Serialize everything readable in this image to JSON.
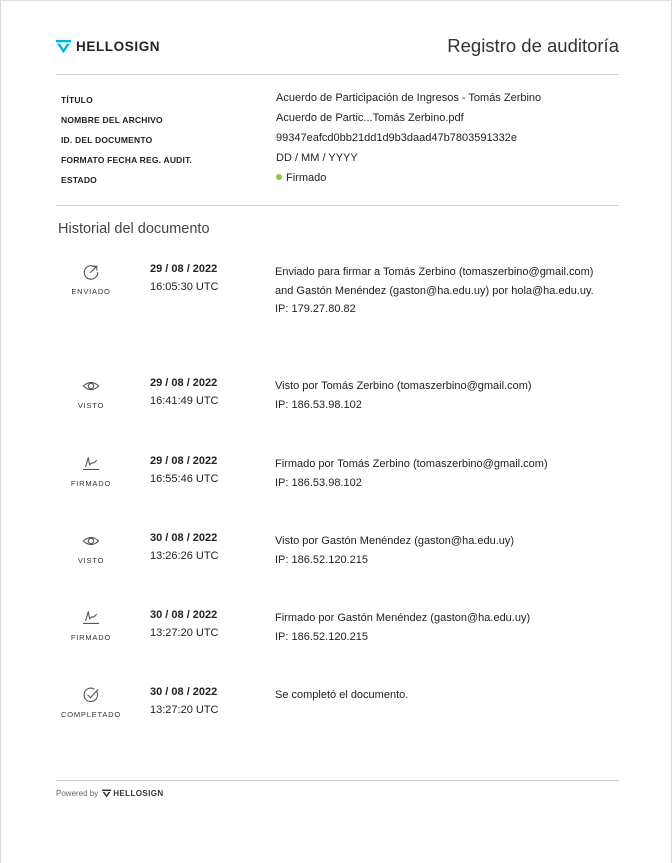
{
  "brand": {
    "name": "HELLOSIGN",
    "accent": "#00b3e6"
  },
  "header": {
    "title": "Registro de auditoría"
  },
  "metadata": [
    {
      "label": "TÍTULO",
      "value": "Acuerdo de Participación de Ingresos - Tomás Zerbino"
    },
    {
      "label": "NOMBRE DEL ARCHIVO",
      "value": "Acuerdo de Partic...Tomás Zerbino.pdf"
    },
    {
      "label": "ID. DEL DOCUMENTO",
      "value": "99347eafcd0bb21dd1d9b3daad47b7803591332e"
    },
    {
      "label": "FORMATO FECHA REG. AUDIT.",
      "value": "DD / MM / YYYY"
    },
    {
      "label": "ESTADO",
      "value": "Firmado",
      "status_color": "#8dc63f"
    }
  ],
  "history": {
    "title": "Historial del documento",
    "events": [
      {
        "icon": "sent-icon",
        "label": "ENVIADO",
        "date": "29 / 08 / 2022",
        "time": "16:05:30 UTC",
        "desc": "Enviado para firmar a Tomás Zerbino (tomaszerbino@gmail.com) and Gastón Menéndez (gaston@ha.edu.uy) por hola@ha.edu.uy.",
        "ip": "IP: 179.27.80.82"
      },
      {
        "icon": "eye-icon",
        "label": "VISTO",
        "date": "29 / 08 / 2022",
        "time": "16:41:49 UTC",
        "desc": "Visto por Tomás Zerbino (tomaszerbino@gmail.com)",
        "ip": "IP: 186.53.98.102"
      },
      {
        "icon": "signature-icon",
        "label": "FIRMADO",
        "date": "29 / 08 / 2022",
        "time": "16:55:46 UTC",
        "desc": "Firmado por Tomás Zerbino (tomaszerbino@gmail.com)",
        "ip": "IP: 186.53.98.102"
      },
      {
        "icon": "eye-icon",
        "label": "VISTO",
        "date": "30 / 08 / 2022",
        "time": "13:26:26 UTC",
        "desc": "Visto por Gastón Menéndez (gaston@ha.edu.uy)",
        "ip": "IP: 186.52.120.215"
      },
      {
        "icon": "signature-icon",
        "label": "FIRMADO",
        "date": "30 / 08 / 2022",
        "time": "13:27:20 UTC",
        "desc": "Firmado por Gastón Menéndez (gaston@ha.edu.uy)",
        "ip": "IP: 186.52.120.215"
      },
      {
        "icon": "check-circle-icon",
        "label": "COMPLETADO",
        "date": "30 / 08 / 2022",
        "time": "13:27:20 UTC",
        "desc": "Se completó el documento.",
        "ip": ""
      }
    ]
  },
  "footer": {
    "powered_by": "Powered by",
    "brand": "HELLOSIGN"
  }
}
